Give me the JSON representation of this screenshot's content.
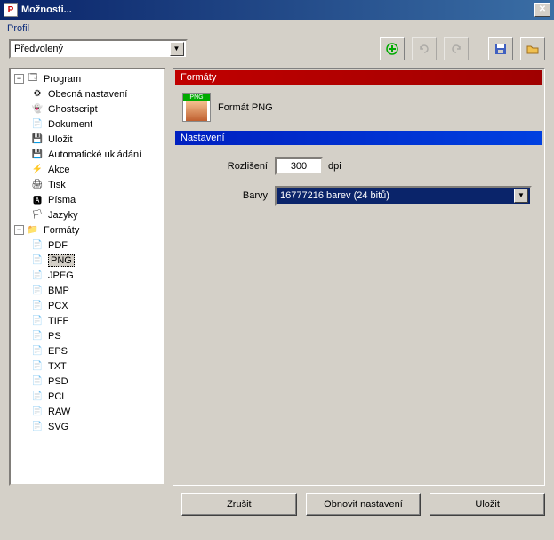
{
  "window": {
    "title": "Možnosti..."
  },
  "profile": {
    "label": "Profil",
    "value": "Předvolený"
  },
  "toolbar": {
    "add": "+",
    "undo": "↶",
    "redo": "↷",
    "save": "💾",
    "open": "📂"
  },
  "tree": {
    "program": {
      "label": "Program",
      "items": [
        "Obecná nastavení",
        "Ghostscript",
        "Dokument",
        "Uložit",
        "Automatické ukládání",
        "Akce",
        "Tisk",
        "Písma",
        "Jazyky"
      ]
    },
    "formats": {
      "label": "Formáty",
      "items": [
        "PDF",
        "PNG",
        "JPEG",
        "BMP",
        "PCX",
        "TIFF",
        "PS",
        "EPS",
        "TXT",
        "PSD",
        "PCL",
        "RAW",
        "SVG"
      ]
    }
  },
  "right": {
    "formats_header": "Formáty",
    "format_name": "Formát PNG",
    "format_badge": "PNG",
    "settings_header": "Nastavení",
    "resolution_label": "Rozlišení",
    "resolution_value": "300",
    "resolution_unit": "dpi",
    "colors_label": "Barvy",
    "colors_value": "16777216 barev (24 bitů)"
  },
  "buttons": {
    "cancel": "Zrušit",
    "restore": "Obnovit nastavení",
    "save": "Uložit"
  }
}
